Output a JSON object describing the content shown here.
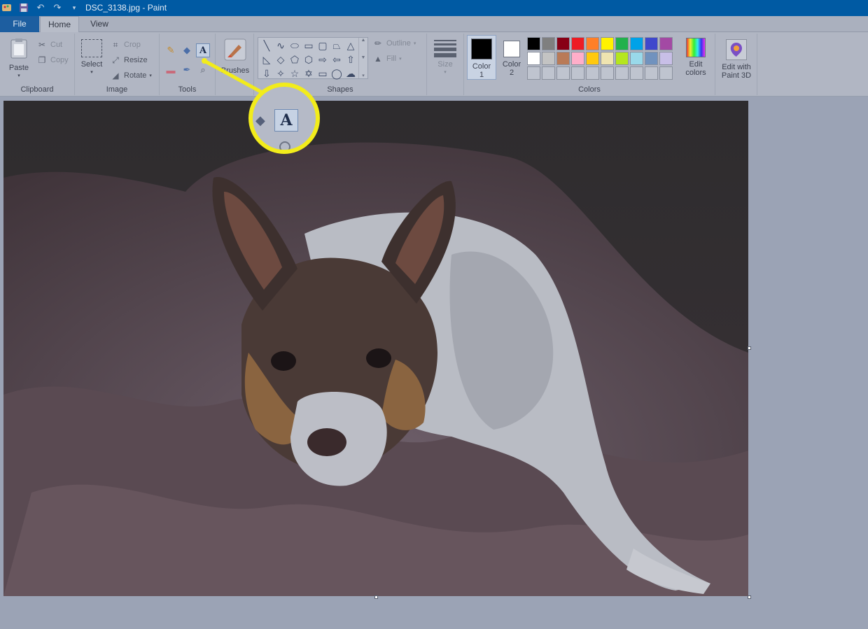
{
  "window": {
    "title": "DSC_3138.jpg - Paint"
  },
  "quick_access": [
    {
      "icon": "paint-app-icon"
    },
    {
      "icon": "save-icon"
    },
    {
      "icon": "undo-icon"
    },
    {
      "icon": "redo-icon"
    },
    {
      "icon": "customize-quick-access-icon"
    }
  ],
  "tabs": {
    "file": "File",
    "home": "Home",
    "view": "View",
    "active": "Home"
  },
  "ribbon": {
    "clipboard": {
      "label": "Clipboard",
      "paste": "Paste",
      "cut": "Cut",
      "copy": "Copy"
    },
    "image": {
      "label": "Image",
      "select": "Select",
      "crop": "Crop",
      "resize": "Resize",
      "rotate": "Rotate"
    },
    "tools": {
      "label": "Tools",
      "active_tool": "text-tool",
      "text_glyph": "A"
    },
    "brushes": {
      "label": "Brushes"
    },
    "shapes": {
      "label": "Shapes",
      "outline": "Outline",
      "fill": "Fill",
      "items": [
        "line",
        "curve",
        "oval",
        "rectangle",
        "rounded-rectangle",
        "polygon",
        "triangle",
        "right-triangle",
        "diamond",
        "pentagon",
        "hexagon",
        "right-arrow",
        "left-arrow",
        "up-arrow",
        "down-arrow",
        "four-point-star",
        "five-point-star",
        "six-point-star",
        "rounded-callout",
        "oval-callout",
        "cloud-callout"
      ]
    },
    "size": {
      "label": "Size"
    },
    "colors": {
      "label": "Colors",
      "color1": {
        "label_line1": "Color",
        "label_line2": "1",
        "value": "#000000"
      },
      "color2": {
        "label_line1": "Color",
        "label_line2": "2",
        "value": "#ffffff"
      },
      "palette": [
        "#000000",
        "#7f7f7f",
        "#880015",
        "#ed1c24",
        "#ff7f27",
        "#fff200",
        "#22b14c",
        "#00a2e8",
        "#3f48cc",
        "#a349a4",
        "#ffffff",
        "#c3c3c3",
        "#b97a57",
        "#ffaec9",
        "#ffc90e",
        "#efe4b0",
        "#b5e61d",
        "#99d9ea",
        "#7092be",
        "#c8bfe7",
        "",
        "",
        "",
        "",
        "",
        "",
        "",
        "",
        "",
        ""
      ],
      "edit_colors_line1": "Edit",
      "edit_colors_line2": "colors"
    },
    "paint3d": {
      "line1": "Edit with",
      "line2": "Paint 3D"
    }
  },
  "canvas": {
    "image_description": "photo"
  },
  "callout": {
    "highlighted_tool": "text-tool",
    "accent": "#f2ec1b",
    "glyph": "A"
  },
  "theme": {
    "titlebar": "#005aa3",
    "file_tab": "#1d5ea0",
    "overlay": "#9ba3b5"
  }
}
